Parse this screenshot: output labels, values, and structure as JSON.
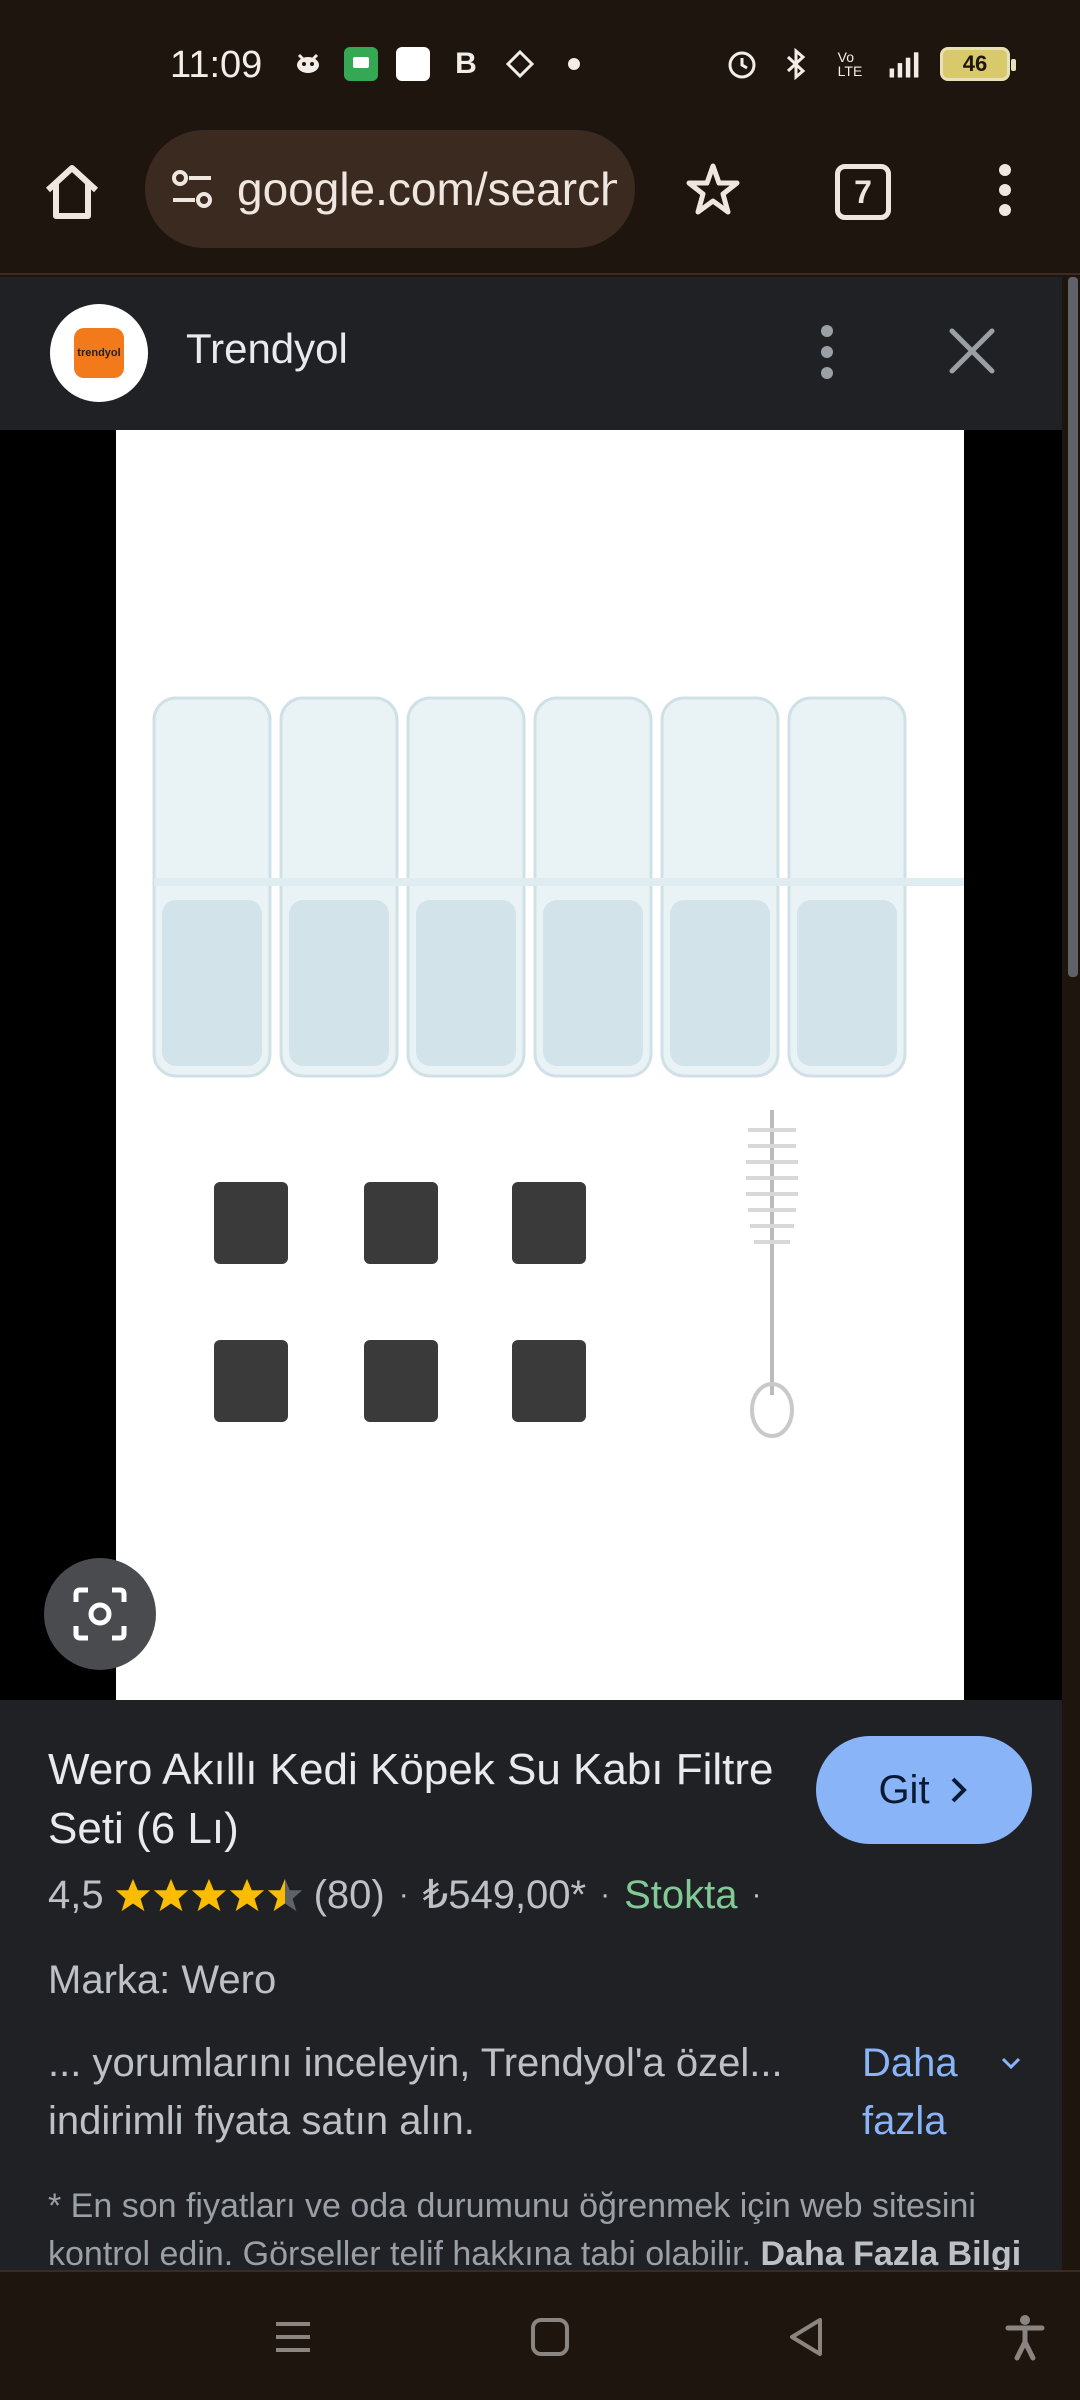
{
  "status_bar": {
    "time": "11:09",
    "battery": "46",
    "left_icons": [
      "android-debug-icon",
      "messages-icon",
      "white-square-icon",
      "bold-b-icon",
      "diamond-icon",
      "dot-icon"
    ],
    "right_icons": [
      "alarm-icon",
      "bluetooth-icon",
      "volte-icon",
      "signal-icon",
      "battery-icon"
    ]
  },
  "browser": {
    "url": "google.com/search",
    "tab_count": "7"
  },
  "source": {
    "name": "Trendyol",
    "logo_text": "trendyol"
  },
  "product": {
    "title": "Wero Akıllı Kedi Köpek Su Kabı Filtre Seti (6 Lı)",
    "go_button": "Git",
    "rating": "4,5",
    "reviews": "(80)",
    "price": "₺549,00*",
    "availability": "Stokta",
    "brand_line": "Marka: Wero",
    "snippet": "... yorumlarını inceleyin, Trendyol'a özel... indirimli fiyata satın alın.",
    "more_label": "Daha fazla",
    "disclaimer": "* En son fiyatları ve oda durumunu öğrenmek için web sitesini kontrol edin. Görseller telif hakkına tabi olabilir.",
    "disclaimer_link": "Daha Fazla Bilgi"
  },
  "colors": {
    "accent": "#8ab4f8",
    "in_stock": "#81c995",
    "star": "#fbbc04",
    "logo_orange": "#f27a1a"
  }
}
